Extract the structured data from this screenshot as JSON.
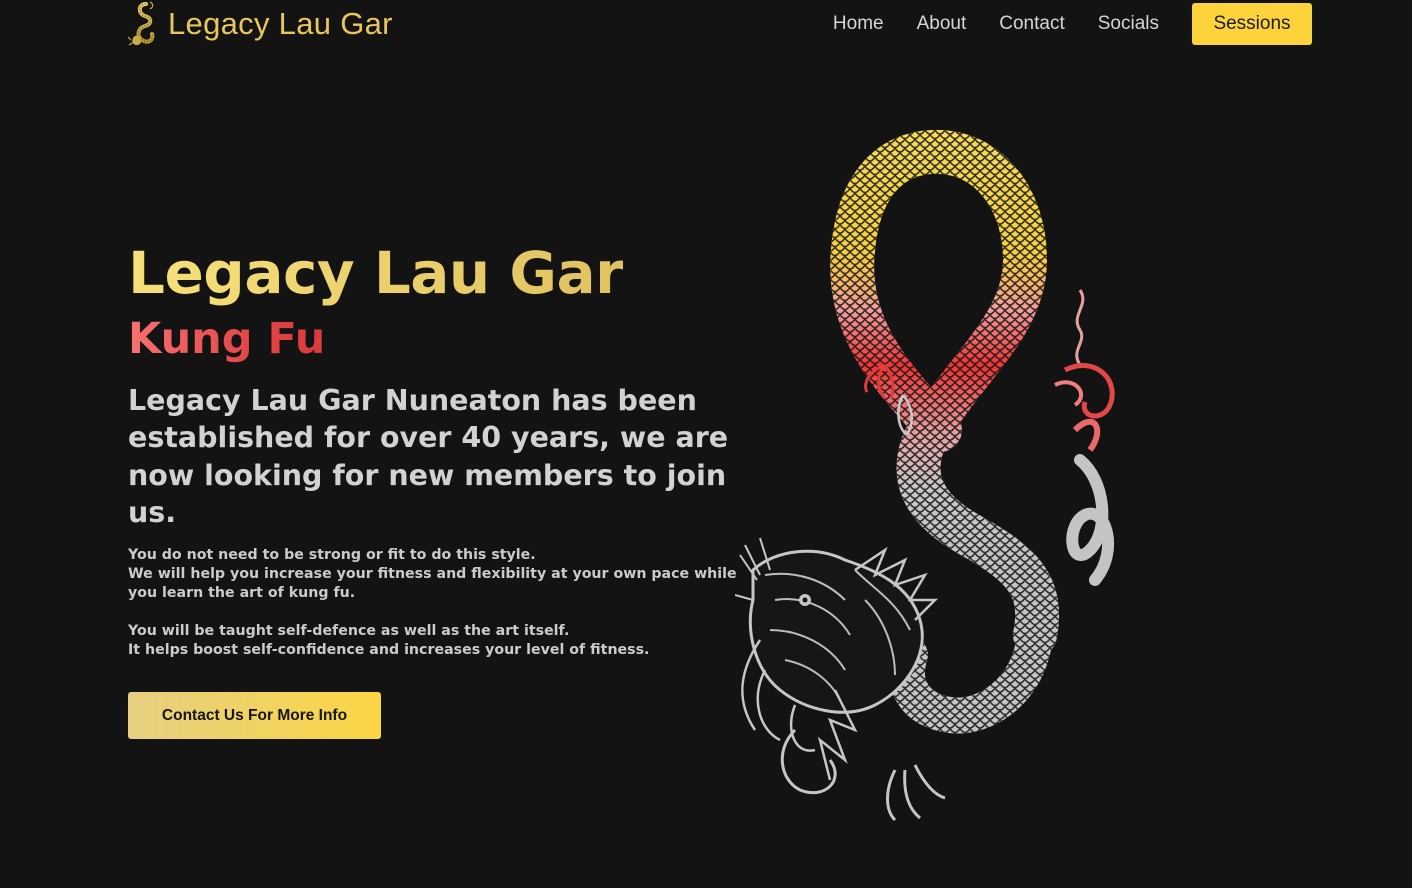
{
  "header": {
    "brand_name": "Legacy Lau Gar",
    "logo_icon": "dragon-logo-icon",
    "nav": [
      {
        "label": "Home"
      },
      {
        "label": "About"
      },
      {
        "label": "Contact"
      },
      {
        "label": "Socials"
      }
    ],
    "cta_label": "Sessions"
  },
  "hero": {
    "title": "Legacy Lau Gar",
    "subtitle": "Kung Fu",
    "lead": "Legacy Lau Gar Nuneaton has been established for over 40 years, we are now looking for new members to join us.",
    "body_lines": [
      "You do not need to be strong or fit to do this style.",
      "We will help you increase your fitness and flexibility at your own pace while you learn the art of kung fu.",
      "You will be taught self-defence as well as the art itself.",
      "It helps boost self-confidence and increases your level of fitness."
    ],
    "cta_label": "Contact Us For More Info",
    "illustration": "dragon-illustration"
  },
  "colors": {
    "background": "#131314",
    "accent_gold": "#fdd33b",
    "title_gold": "#e7c65a",
    "subtitle_red": "#e34848",
    "text_light": "#d2d2d2"
  }
}
